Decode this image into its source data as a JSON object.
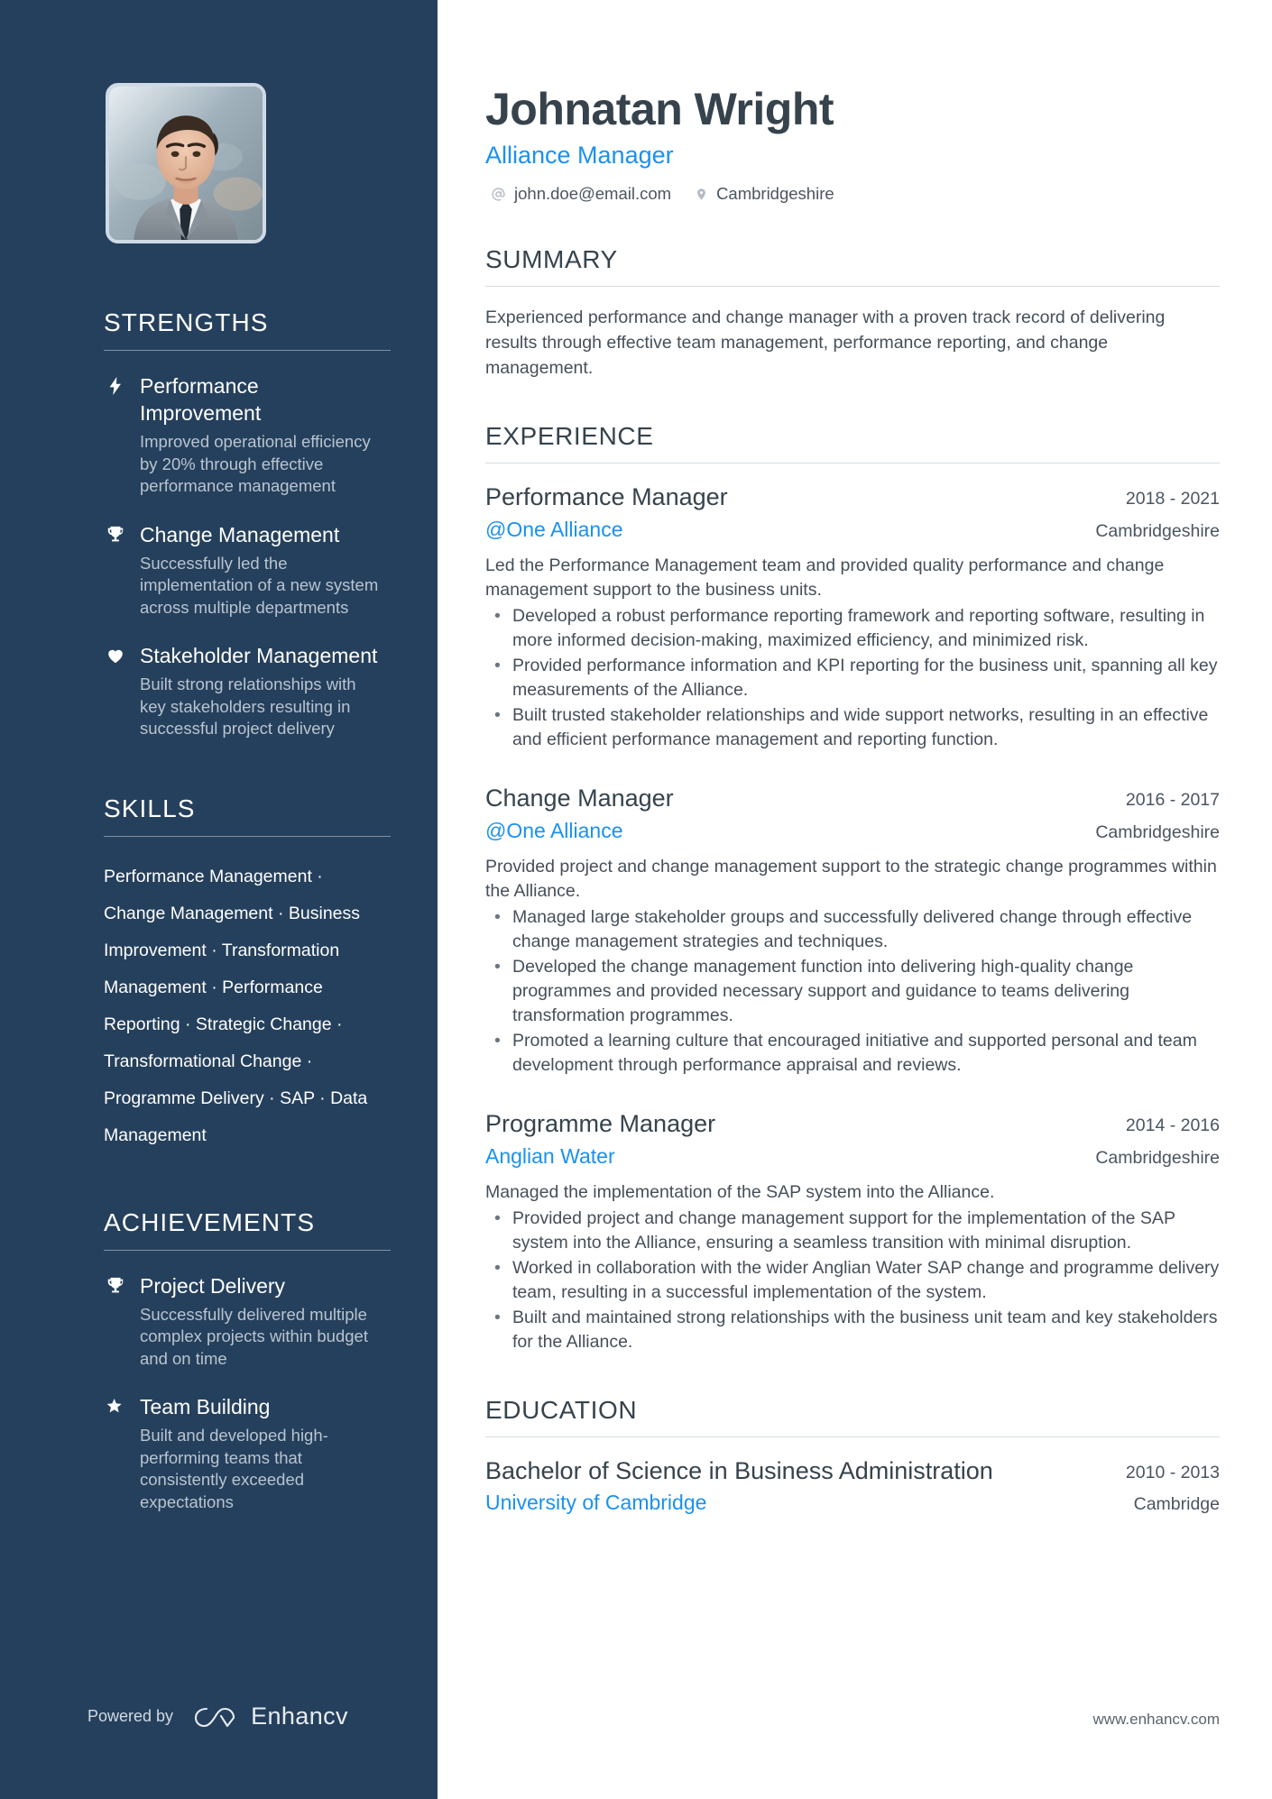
{
  "header": {
    "name": "Johnatan Wright",
    "role": "Alliance Manager",
    "email": "john.doe@email.com",
    "location": "Cambridgeshire",
    "email_icon": "at-sign-icon",
    "location_icon": "map-pin-icon"
  },
  "sidebar": {
    "strengths": {
      "heading": "STRENGTHS",
      "items": [
        {
          "icon": "lightning-bolt-icon",
          "title": "Performance Improvement",
          "desc": "Improved operational efficiency by 20% through effective performance management"
        },
        {
          "icon": "trophy-icon",
          "title": "Change Management",
          "desc": "Successfully led the implementation of a new system across multiple departments"
        },
        {
          "icon": "heart-icon",
          "title": "Stakeholder Management",
          "desc": "Built strong relationships with key stakeholders resulting in successful project delivery"
        }
      ]
    },
    "skills": {
      "heading": "SKILLS",
      "items": [
        "Performance Management",
        "Change Management",
        "Business Improvement",
        "Transformation Management",
        "Performance Reporting",
        "Strategic Change",
        "Transformational Change",
        "Programme Delivery",
        "SAP",
        "Data Management"
      ],
      "separator": "·"
    },
    "achievements": {
      "heading": "ACHIEVEMENTS",
      "items": [
        {
          "icon": "trophy-icon",
          "title": "Project Delivery",
          "desc": "Successfully delivered multiple complex projects within budget and on time"
        },
        {
          "icon": "star-icon",
          "title": "Team Building",
          "desc": "Built and developed high-performing teams that consistently exceeded expectations"
        }
      ]
    },
    "footer": {
      "powered_by": "Powered by",
      "brand": "Enhancv",
      "brand_mark": "enhancv-logo-icon"
    }
  },
  "main": {
    "summary": {
      "heading": "SUMMARY",
      "text": "Experienced performance and change manager with a proven track record of delivering results through effective team management, performance reporting, and change management."
    },
    "experience": {
      "heading": "EXPERIENCE",
      "jobs": [
        {
          "title": "Performance Manager",
          "company": "@One Alliance",
          "dates": "2018 - 2021",
          "location": "Cambridgeshire",
          "desc": "Led the Performance Management team and provided quality performance and change management support to the business units.",
          "bullets": [
            "Developed a robust performance reporting framework and reporting software, resulting in more informed decision-making, maximized efficiency, and minimized risk.",
            "Provided performance information and KPI reporting for the business unit, spanning all key measurements of the Alliance.",
            "Built trusted stakeholder relationships and wide support networks, resulting in an effective and efficient performance management and reporting function."
          ]
        },
        {
          "title": "Change Manager",
          "company": "@One Alliance",
          "dates": "2016 - 2017",
          "location": "Cambridgeshire",
          "desc": "Provided project and change management support to the strategic change programmes within the Alliance.",
          "bullets": [
            "Managed large stakeholder groups and successfully delivered change through effective change management strategies and techniques.",
            "Developed the change management function into delivering high-quality change programmes and provided necessary support and guidance to teams delivering transformation programmes.",
            "Promoted a learning culture that encouraged initiative and supported personal and team development through performance appraisal and reviews."
          ]
        },
        {
          "title": "Programme Manager",
          "company": "Anglian Water",
          "dates": "2014 - 2016",
          "location": "Cambridgeshire",
          "desc": "Managed the implementation of the SAP system into the Alliance.",
          "bullets": [
            "Provided project and change management support for the implementation of the SAP system into the Alliance, ensuring a seamless transition with minimal disruption.",
            "Worked in collaboration with the wider Anglian Water SAP change and programme delivery team, resulting in a successful implementation of the system.",
            "Built and maintained strong relationships with the business unit team and key stakeholders for the Alliance."
          ]
        }
      ]
    },
    "education": {
      "heading": "EDUCATION",
      "entries": [
        {
          "degree": "Bachelor of Science in Business Administration",
          "school": "University of Cambridge",
          "dates": "2010 - 2013",
          "location": "Cambridge"
        }
      ]
    },
    "footer_url": "www.enhancv.com"
  },
  "colors": {
    "sidebar_bg": "#25405c",
    "accent_blue": "#1a91f0",
    "heading_dark": "#36434c",
    "body_text": "#454f59",
    "muted_sidebar_text": "#b9c4d0"
  }
}
